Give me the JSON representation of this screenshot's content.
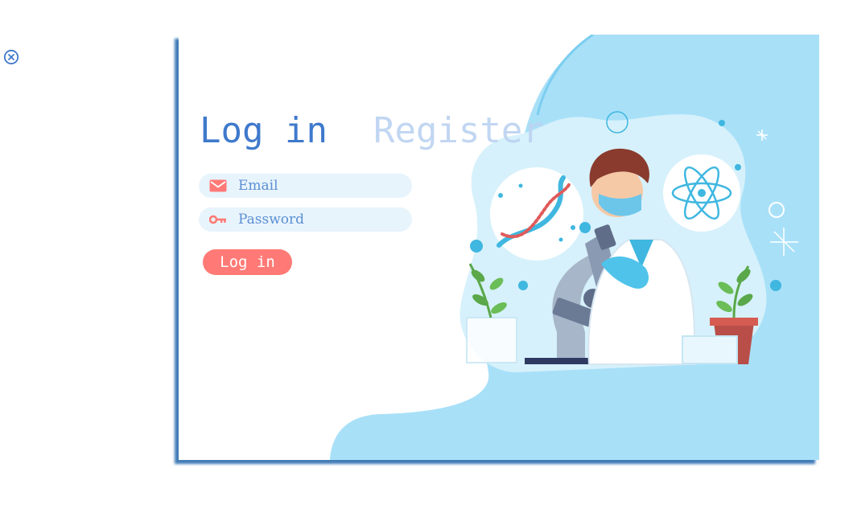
{
  "colors": {
    "accent": "#3f79cc",
    "inactive_tab": "#bcd3f1",
    "button": "#ff7a76",
    "field_bg": "#e8f4fc",
    "field_text": "#5b8fd4",
    "panel_blue": "#a8e0f8",
    "shadow": "#1e64aa"
  },
  "close": {
    "icon": "close-circle-icon"
  },
  "tabs": {
    "login": "Log in",
    "register": "Register"
  },
  "form": {
    "email": {
      "placeholder": "Email",
      "icon": "envelope-icon"
    },
    "password": {
      "placeholder": "Password",
      "icon": "key-icon"
    },
    "submit_label": "Log in"
  },
  "illustration": {
    "icon": "scientist-microscope-illustration"
  }
}
